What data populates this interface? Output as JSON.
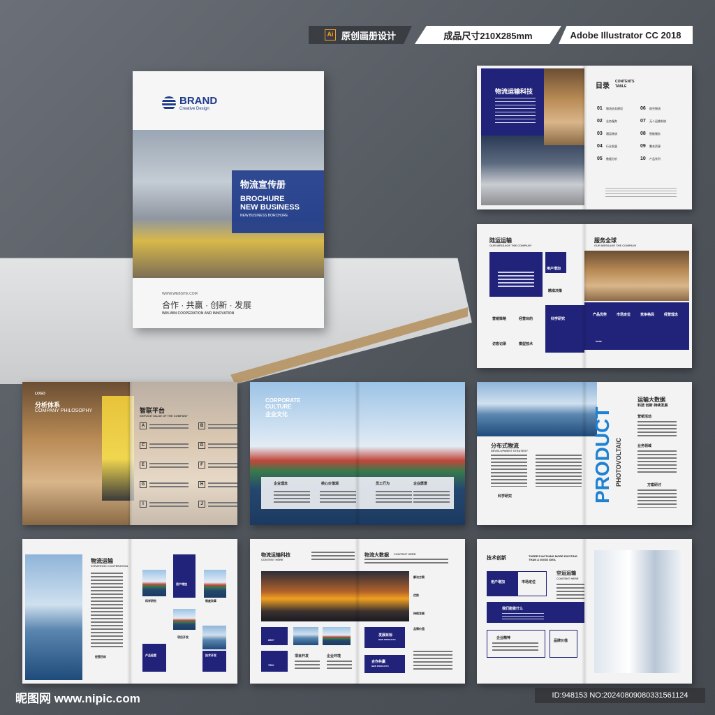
{
  "header": {
    "ai_badge": "Ai",
    "tag1": "原创画册设计",
    "tag2": "成品尺寸210X285mm",
    "tag3": "Adobe Illustrator CC 2018"
  },
  "cover": {
    "brand": "BRAND",
    "brand_sub": "Creative Design",
    "title_cn": "物流宣传册",
    "title_en1": "BROCHURE",
    "title_en2": "NEW BUSINESS",
    "title_small": "NEW BUSINESS BORCHURE",
    "website": "WWW.WEBSITE.COM",
    "slogan": "合作 · 共赢 · 创新 · 发展",
    "slogan_en": "WIN-WIN COOPERATION AND INNOVATION"
  },
  "spread1": {
    "left_title": "物流运输科技",
    "toc_title": "目录",
    "toc_en1": "CONTENTS",
    "toc_en2": "TABLE",
    "toc_items": [
      {
        "num": "01",
        "label": "物流业务建设"
      },
      {
        "num": "02",
        "label": "业务服务"
      },
      {
        "num": "03",
        "label": "通运物流"
      },
      {
        "num": "04",
        "label": "行业发展"
      },
      {
        "num": "05",
        "label": "数据分析"
      },
      {
        "num": "06",
        "label": "航空物流"
      },
      {
        "num": "07",
        "label": "无人运输系统"
      },
      {
        "num": "08",
        "label": "智能服务"
      },
      {
        "num": "09",
        "label": "整合资源"
      },
      {
        "num": "10",
        "label": "产品系列"
      }
    ]
  },
  "spread2": {
    "left_title": "陆运运输",
    "left_sub": "OUR MESSAGE THE COMPANY",
    "right_title": "服务全球",
    "right_sub": "OUR MESSAGE THE COMPANY",
    "labels": [
      "用户增加",
      "精准决策",
      "营销策略",
      "经营目的",
      "科学研究",
      "访客记录",
      "模型技术"
    ],
    "right_labels": [
      "产品优势",
      "市场定位",
      "竞争格局",
      "经营理念"
    ],
    "more": "MORE"
  },
  "spread3": {
    "logo": "LOGO",
    "title_cn": "分析体系",
    "title_en": "COMPANY PHILOSOPHY",
    "right_title": "智联平台",
    "right_sub": "SERVICE VALUE OF THE COMPANY",
    "letters": [
      "A",
      "B",
      "C",
      "D",
      "E",
      "F",
      "G",
      "H",
      "I",
      "J"
    ]
  },
  "spread4": {
    "title_en1": "CORPORATE",
    "title_en2": "CULTURE",
    "title_cn": "企业文化",
    "items": [
      "企业理念",
      "核心价值观",
      "员工行为",
      "企业愿景"
    ]
  },
  "spread5": {
    "left_title": "分布式物流",
    "left_sub": "DEVELOPMENT STRATEGY",
    "right_title": "运输大数据",
    "right_sub": "科技·创新·持续发展",
    "items": [
      "营销活动",
      "业务领域",
      "方案研讨",
      "科学研究"
    ],
    "product": "PRODUCT",
    "photovoltaic": "PHOTOVOLTAIC"
  },
  "spread6": {
    "title": "物流运输",
    "sub": "STRATEGIC COOPERATION",
    "labels": [
      "用户增加",
      "科学研究",
      "制度改革",
      "项目开发",
      "产品经营",
      "技术开发",
      "经营目标"
    ]
  },
  "spread7": {
    "left_title": "物流运输科技",
    "left_sub": "CONTENT HERE",
    "right_title": "物流大数据",
    "right_sub": "CONTENT HERE",
    "items": [
      "解决方案",
      "优势",
      "持续发展",
      "品牌价值"
    ],
    "labels": [
      "发展目标",
      "项目开发",
      "企业环境",
      "合作共赢"
    ],
    "label_en": "NEW PRODUCTS",
    "nums": [
      "850+",
      "750+"
    ]
  },
  "spread8": {
    "title": "技术创新",
    "sub": "THERE'S NOTHING MORE EXCITING THAN A GOOD IDEA",
    "right_title": "空运运输",
    "right_sub": "CONTENT HERE",
    "labels": [
      "用户增加",
      "市场定位",
      "我们能做什么",
      "企业精神",
      "品牌价值"
    ]
  },
  "watermark": {
    "site": "昵图网 www.nipic.com",
    "id": "ID:948153 NO:20240809080331561124"
  }
}
